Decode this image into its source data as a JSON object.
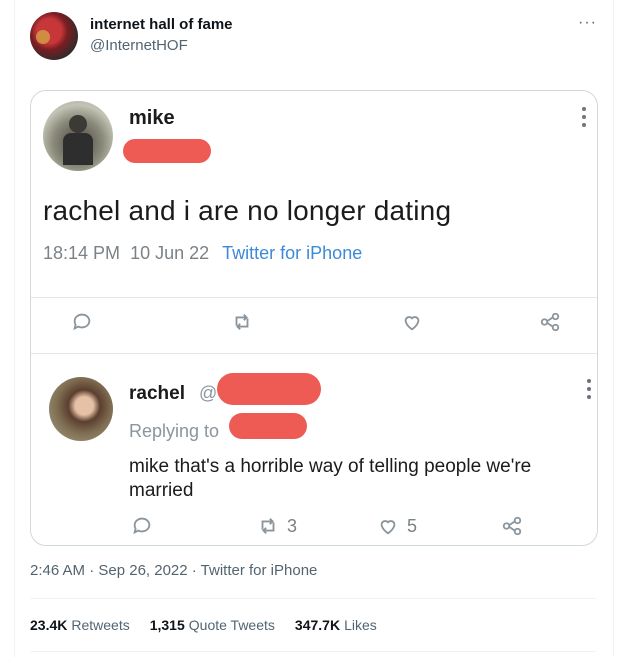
{
  "header": {
    "name": "internet hall of fame",
    "handle": "@InternetHOF",
    "more_icon": "more-horizontal-icon"
  },
  "embedded": {
    "mike": {
      "name": "mike",
      "text": "rachel and i are no longer dating",
      "time": "18:14 PM",
      "date": "10 Jun 22",
      "source": "Twitter for iPhone"
    },
    "rachel": {
      "name": "rachel",
      "at": "@",
      "replying": "Replying to",
      "text": "mike that's a horrible way of telling people we're married",
      "retweets": "3",
      "likes": "5"
    },
    "redaction_color": "#ee5b55"
  },
  "footer": {
    "timestamp": "2:46 AM · Sep 26, 2022 · Twitter for iPhone",
    "retweets_count": "23.4K",
    "retweets_label": "Retweets",
    "quotes_count": "1,315",
    "quotes_label": "Quote Tweets",
    "likes_count": "347.7K",
    "likes_label": "Likes"
  }
}
